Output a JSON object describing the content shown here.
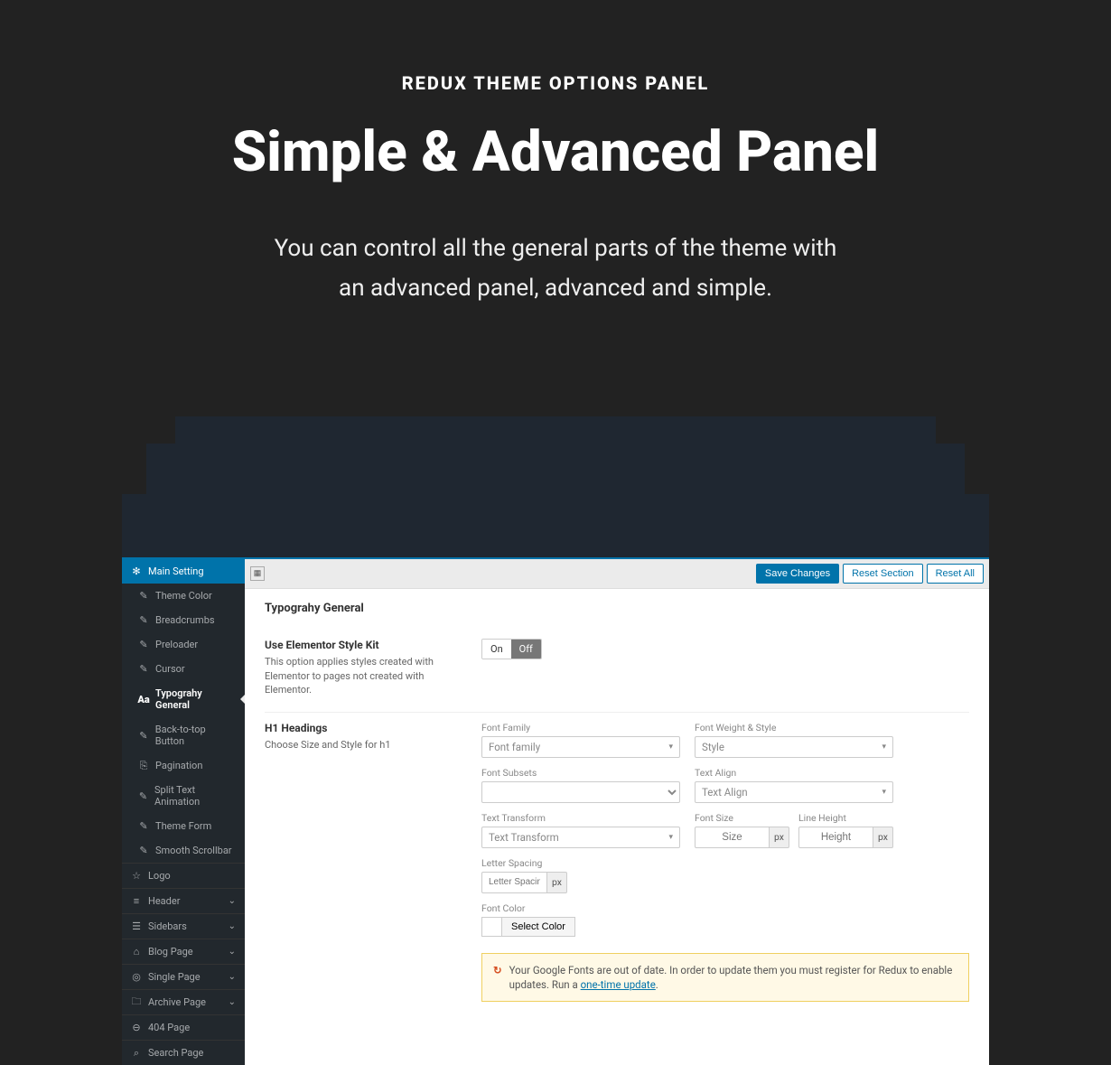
{
  "hero": {
    "eyebrow": "REDUX THEME OPTIONS PANEL",
    "title": "Simple & Advanced Panel",
    "desc1": "You can control all the general parts of the theme with",
    "desc2": "an advanced panel, advanced and simple."
  },
  "topbar": {
    "save": "Save Changes",
    "reset_section": "Reset Section",
    "reset_all": "Reset All"
  },
  "sidebar": {
    "main": "Main Setting",
    "sub": [
      "Theme Color",
      "Breadcrumbs",
      "Preloader",
      "Cursor",
      "Typograhy General",
      "Back-to-top Button",
      "Pagination",
      "Split Text Animation",
      "Theme Form",
      "Smooth Scrollbar"
    ],
    "tops": [
      "Logo",
      "Header",
      "Sidebars",
      "Blog Page",
      "Single Page",
      "Archive Page",
      "404 Page",
      "Search Page"
    ]
  },
  "section": {
    "title": "Typograhy General",
    "kit_label": "Use Elementor Style Kit",
    "kit_desc": "This option applies styles created with Elementor to pages not created with Elementor.",
    "on": "On",
    "off": "Off",
    "h1_label": "H1 Headings",
    "h1_desc": "Choose Size and Style for h1",
    "ff": "Font Family",
    "ff_ph": "Font family",
    "fw": "Font Weight & Style",
    "fw_ph": "Style",
    "fs": "Font Subsets",
    "ta": "Text Align",
    "ta_ph": "Text Align",
    "tt": "Text Transform",
    "tt_ph": "Text Transform",
    "fsize": "Font Size",
    "fsize_ph": "Size",
    "lh": "Line Height",
    "lh_ph": "Height",
    "ls": "Letter Spacing",
    "ls_ph": "Letter Spacing",
    "fc": "Font Color",
    "sc": "Select Color",
    "px": "px"
  },
  "notice": {
    "text1": "Your Google Fonts are out of date. In order to update them you must register for Redux to enable updates. Run a ",
    "link": "one-time update",
    "text2": "."
  }
}
